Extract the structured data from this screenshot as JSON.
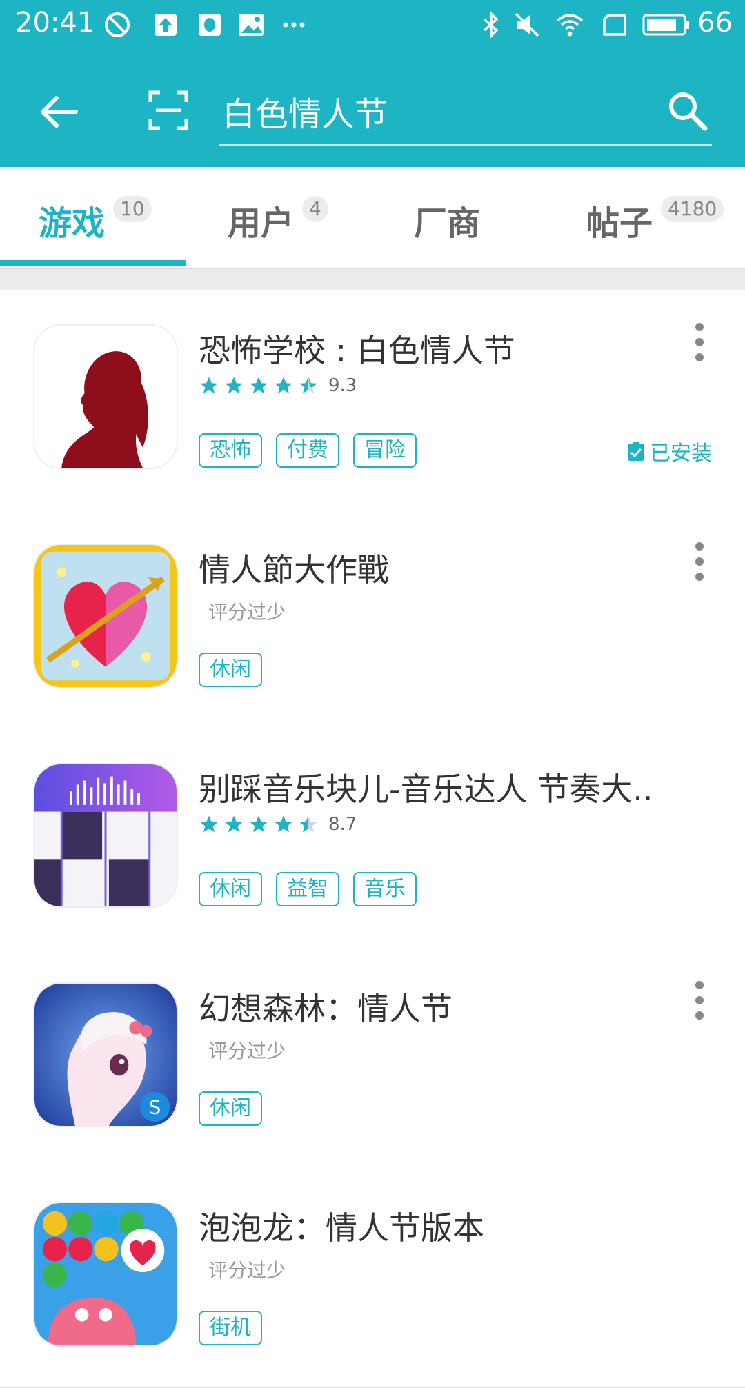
{
  "status_bar": {
    "time": "20:41",
    "battery": "66"
  },
  "search": {
    "query": "白色情人节"
  },
  "tabs": [
    {
      "label": "游戏",
      "badge": "10",
      "active": true
    },
    {
      "label": "用户",
      "badge": "4",
      "active": false
    },
    {
      "label": "厂商",
      "badge": "",
      "active": false
    },
    {
      "label": "帖子",
      "badge": "4180",
      "active": false
    }
  ],
  "results": [
    {
      "title": "恐怖学校 : 白色情人节",
      "score": "9.3",
      "stars": 4.5,
      "no_rating": "",
      "tags": [
        "恐怖",
        "付费",
        "冒险"
      ],
      "installed": "已安装",
      "icon": "horror-school-icon"
    },
    {
      "title": "情人節大作戰",
      "score": "",
      "stars": 0,
      "no_rating": "评分过少",
      "tags": [
        "休闲"
      ],
      "installed": "",
      "icon": "heart-arrow-icon"
    },
    {
      "title": "别踩音乐块儿-音乐达人 节奏大..",
      "score": "8.7",
      "stars": 4.5,
      "no_rating": "",
      "tags": [
        "休闲",
        "益智",
        "音乐"
      ],
      "installed": "",
      "icon": "piano-tiles-icon"
    },
    {
      "title": "幻想森林：情人节",
      "score": "",
      "stars": 0,
      "no_rating": "评分过少",
      "tags": [
        "休闲"
      ],
      "installed": "",
      "icon": "pony-icon"
    },
    {
      "title": "泡泡龙：情人节版本",
      "score": "",
      "stars": 0,
      "no_rating": "评分过少",
      "tags": [
        "街机"
      ],
      "installed": "",
      "icon": "bubble-icon"
    }
  ],
  "colors": {
    "accent": "#1db4c3",
    "text": "#333333",
    "muted": "#999999"
  }
}
